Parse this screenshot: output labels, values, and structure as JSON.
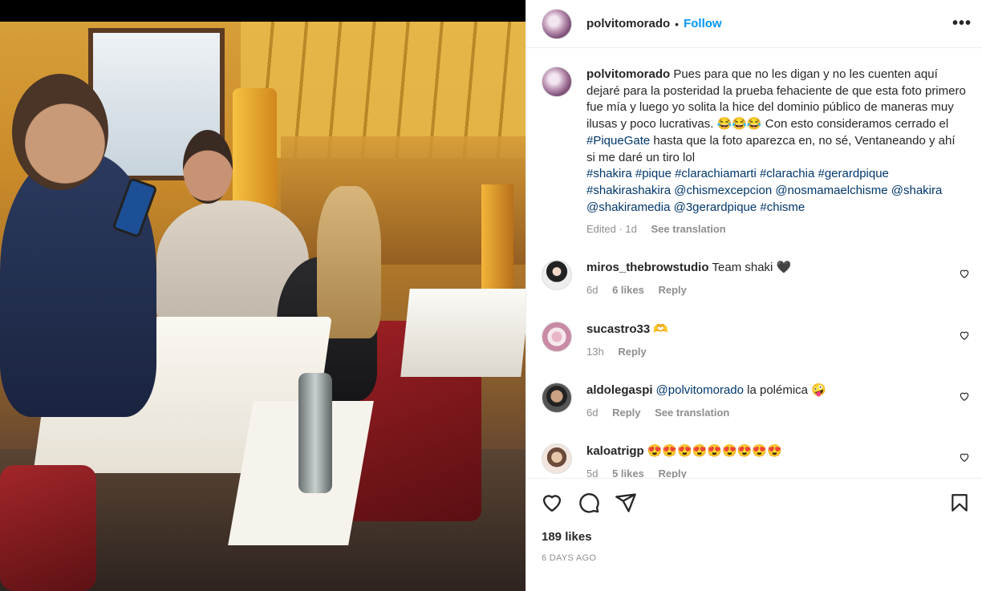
{
  "post": {
    "username": "polvitomorado",
    "follow_label": "Follow",
    "separator": "•",
    "more_label": "•••"
  },
  "caption": {
    "username": "polvitomorado",
    "text": " Pues para que no les digan y no les cuenten aquí dejaré para la posteridad la prueba fehaciente de que esta foto primero fue mía y luego yo solita la hice del dominio público de maneras muy ilusas y poco lucrativas. 😂😂😂 Con esto consideramos cerrado el ",
    "hashtag_piquegate": "#PiqueGate",
    "text2": " hasta que la foto aparezca en, no sé, Ventaneando y ahí si me daré un tiro lol",
    "tags": "#shakira #pique #clarachiamarti #clarachia #gerardpique #shakirashakira @chismexcepcion @nosmamaelchisme @shakira @shakiramedia @3gerardpique #chisme",
    "edited": "Edited · 1d",
    "see_translation": "See translation"
  },
  "comments": [
    {
      "username": "miros_thebrowstudio",
      "text": "Team shaki 🖤",
      "time": "6d",
      "likes": "6 likes",
      "reply": "Reply"
    },
    {
      "username": "sucastro33",
      "text": "🫶",
      "time": "13h",
      "reply": "Reply"
    },
    {
      "username": "aldolegaspi",
      "mention": "@polvitomorado",
      "text": " la polémica 🤪",
      "time": "6d",
      "reply": "Reply",
      "see_translation": "See translation"
    },
    {
      "username": "kaloatrigp",
      "text": "😍😍😍😍😍😍😍😍😍",
      "time": "5d",
      "likes": "5 likes",
      "reply": "Reply"
    }
  ],
  "footer": {
    "likes": "189 likes",
    "time": "6 DAYS AGO"
  },
  "icons": [
    "heart-icon",
    "comment-icon",
    "share-icon",
    "bookmark-icon",
    "more-icon"
  ]
}
